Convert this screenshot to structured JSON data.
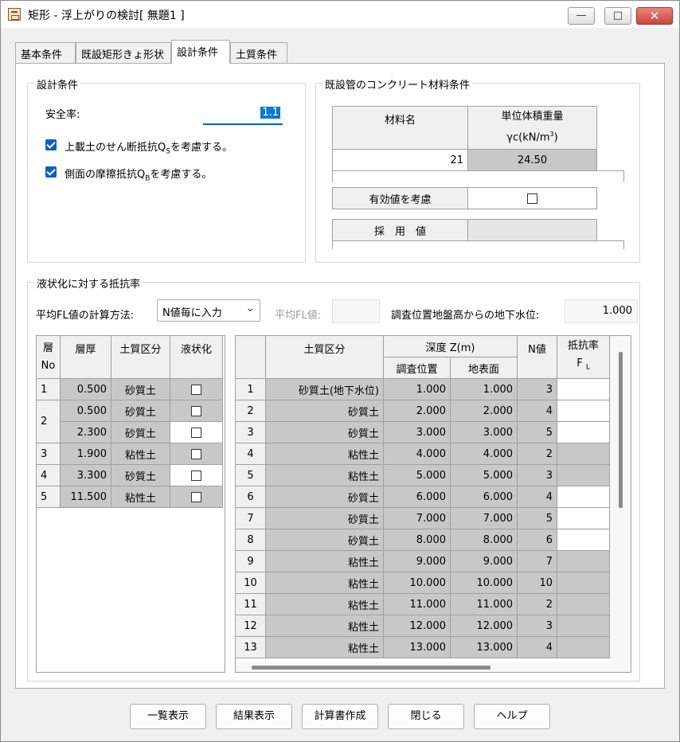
{
  "window": {
    "title": "矩形 - 浮上がりの検討[ 無題1 ]",
    "minimize": "—",
    "maximize": "□",
    "close": "✕"
  },
  "tabs": [
    "基本条件",
    "既設矩形きょ形状",
    "設計条件",
    "土質条件"
  ],
  "design": {
    "group_title": "設計条件",
    "safety_label": "安全率:",
    "safety_value": "1.1",
    "cb1_label": "上載土のせん断抵抗Q",
    "cb1_sub": "S",
    "cb1_tail": "を考慮する。",
    "cb2_label": "側面の摩擦抵抗Q",
    "cb2_sub": "B",
    "cb2_tail": "を考慮する。"
  },
  "concrete": {
    "group_title": "既設管のコンクリート材料条件",
    "col_material": "材料名",
    "col_weight_line1": "単位体積重量",
    "col_weight_line2": "γc(kN/m",
    "col_weight_sup": "3",
    "col_weight_tail": ")",
    "material_value": "21",
    "weight_value": "24.50",
    "effective_label": "有効値を考慮",
    "adopted_label": "採　用　値"
  },
  "liquefaction": {
    "group_title": "液状化に対する抵抗率",
    "method_label": "平均FL値の計算方法:",
    "method_value": "N値毎に入力",
    "avg_fl_label": "平均FL値:",
    "gw_label": "調査位置地盤高からの地下水位:",
    "gw_value": "1.000"
  },
  "layer_table": {
    "headers": {
      "no_1": "層",
      "no_2": "No",
      "thickness": "層厚",
      "soil": "土質区分",
      "liquefy": "液状化"
    },
    "rows": [
      {
        "no": "1",
        "thickness": "0.500",
        "soil": "砂質土"
      },
      {
        "no": "2",
        "thickness": "0.500",
        "soil": "砂質土"
      },
      {
        "no": "",
        "thickness": "2.300",
        "soil": "砂質土"
      },
      {
        "no": "3",
        "thickness": "1.900",
        "soil": "粘性土"
      },
      {
        "no": "4",
        "thickness": "3.300",
        "soil": "砂質土"
      },
      {
        "no": "5",
        "thickness": "11.500",
        "soil": "粘性土"
      }
    ]
  },
  "n_table": {
    "headers": {
      "soil": "土質区分",
      "depth": "深度 Z(m)",
      "survey": "調査位置",
      "surface": "地表面",
      "n": "N値",
      "fl_1": "抵抗率",
      "fl_2": "F",
      "fl_sub": "L"
    },
    "rows": [
      {
        "no": "1",
        "soil": "砂質土(地下水位)",
        "survey": "1.000",
        "surface": "1.000",
        "n": "3"
      },
      {
        "no": "2",
        "soil": "砂質土",
        "survey": "2.000",
        "surface": "2.000",
        "n": "4"
      },
      {
        "no": "3",
        "soil": "砂質土",
        "survey": "3.000",
        "surface": "3.000",
        "n": "5"
      },
      {
        "no": "4",
        "soil": "粘性土",
        "survey": "4.000",
        "surface": "4.000",
        "n": "2"
      },
      {
        "no": "5",
        "soil": "粘性土",
        "survey": "5.000",
        "surface": "5.000",
        "n": "3"
      },
      {
        "no": "6",
        "soil": "砂質土",
        "survey": "6.000",
        "surface": "6.000",
        "n": "4"
      },
      {
        "no": "7",
        "soil": "砂質土",
        "survey": "7.000",
        "surface": "7.000",
        "n": "5"
      },
      {
        "no": "8",
        "soil": "砂質土",
        "survey": "8.000",
        "surface": "8.000",
        "n": "6"
      },
      {
        "no": "9",
        "soil": "粘性土",
        "survey": "9.000",
        "surface": "9.000",
        "n": "7"
      },
      {
        "no": "10",
        "soil": "粘性土",
        "survey": "10.000",
        "surface": "10.000",
        "n": "10"
      },
      {
        "no": "11",
        "soil": "粘性土",
        "survey": "11.000",
        "surface": "11.000",
        "n": "2"
      },
      {
        "no": "12",
        "soil": "粘性土",
        "survey": "12.000",
        "surface": "12.000",
        "n": "3"
      },
      {
        "no": "13",
        "soil": "粘性土",
        "survey": "13.000",
        "surface": "13.000",
        "n": "4"
      }
    ]
  },
  "buttons": [
    "一覧表示",
    "結果表示",
    "計算書作成",
    "閉じる",
    "ヘルプ"
  ]
}
